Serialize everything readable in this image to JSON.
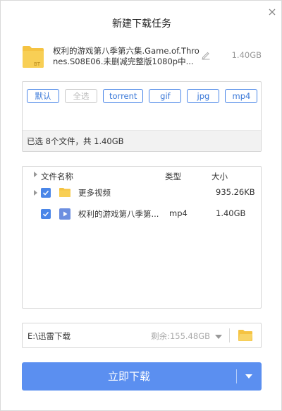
{
  "window": {
    "title": "新建下载任务",
    "close_icon": "close-icon"
  },
  "task": {
    "icon_label": "BT",
    "name": "权利的游戏第八季第六集.Game.of.Thrones.S08E06.未删减完整版1080p中...",
    "size": "1.40GB"
  },
  "filters": {
    "tags": [
      {
        "label": "默认",
        "state": "active"
      },
      {
        "label": "全选",
        "state": "disabled"
      },
      {
        "label": "torrent",
        "state": "active"
      },
      {
        "label": "gif",
        "state": "active"
      },
      {
        "label": "jpg",
        "state": "active"
      },
      {
        "label": "mp4",
        "state": "active"
      }
    ],
    "summary": "已选 8个文件，共 1.40GB"
  },
  "file_list": {
    "headers": {
      "name": "文件名称",
      "type": "类型",
      "size": "大小"
    },
    "rows": [
      {
        "name": "更多视频",
        "type": "",
        "size": "935.26KB",
        "checked": true,
        "kind": "folder"
      },
      {
        "name": "权利的游戏第八季第...",
        "type": "mp4",
        "size": "1.40GB",
        "checked": true,
        "kind": "video"
      }
    ]
  },
  "save_path": {
    "path": "E:\\迅雷下载",
    "remaining": "剩余:155.48GB"
  },
  "download_button": {
    "label": "立即下载"
  },
  "colors": {
    "accent": "#5b8ff0",
    "tag_border": "#4a86e8",
    "folder": "#f5c342"
  }
}
